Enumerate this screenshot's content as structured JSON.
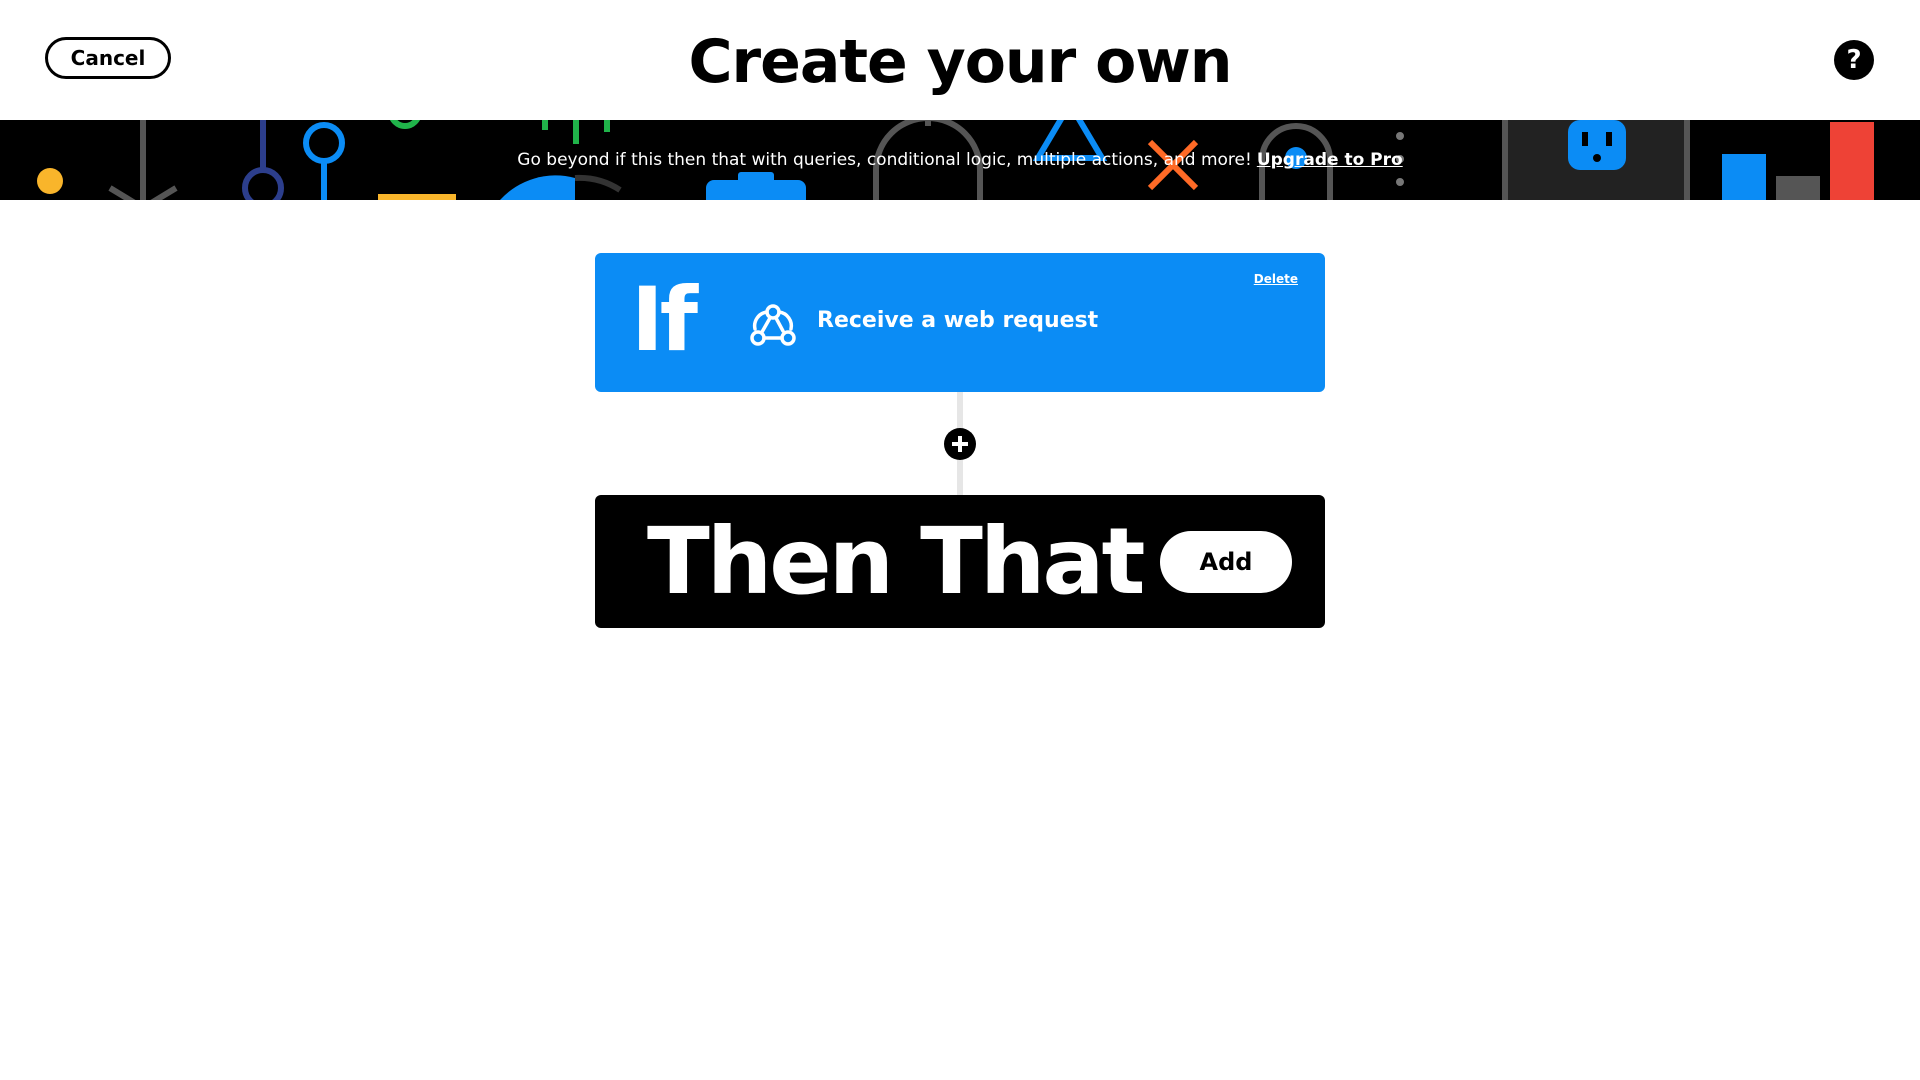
{
  "header": {
    "cancel_label": "Cancel",
    "title": "Create your own",
    "help_icon": "question-icon",
    "help_glyph": "?"
  },
  "banner": {
    "message": "Go beyond if this then that with queries, conditional logic, multiple actions, and more!",
    "link_label": "Upgrade to Pro"
  },
  "trigger": {
    "keyword": "If",
    "icon": "webhook-icon",
    "label": "Receive a web request",
    "delete_label": "Delete",
    "color": "#0b8cf5"
  },
  "add_step": {
    "icon": "plus-icon"
  },
  "action": {
    "keyword": "Then That",
    "add_label": "Add"
  }
}
